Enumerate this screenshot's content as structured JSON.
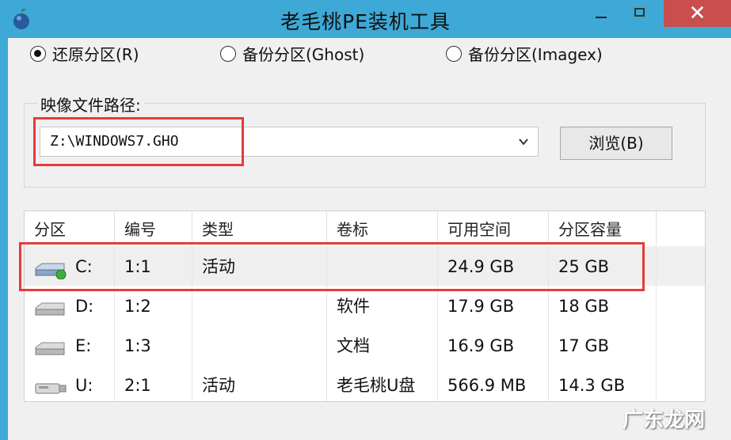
{
  "window": {
    "title": "老毛桃PE装机工具",
    "close_glyph": "✕"
  },
  "mode": {
    "options": [
      {
        "label": "还原分区(R)",
        "checked": true
      },
      {
        "label": "备份分区(Ghost)",
        "checked": false
      },
      {
        "label": "备份分区(Imagex)",
        "checked": false
      }
    ]
  },
  "image_path": {
    "label": "映像文件路径:",
    "value": "Z:\\WINDOWS7.GHO",
    "browse_label": "浏览(B)"
  },
  "partitions": {
    "columns": [
      "分区",
      "编号",
      "类型",
      "卷标",
      "可用空间",
      "分区容量"
    ],
    "rows": [
      {
        "drive": "C:",
        "number": "1:1",
        "type": "活动",
        "label": "",
        "free": "24.9 GB",
        "size": "25 GB",
        "selected": true
      },
      {
        "drive": "D:",
        "number": "1:2",
        "type": "",
        "label": "软件",
        "free": "17.9 GB",
        "size": "18 GB",
        "selected": false
      },
      {
        "drive": "E:",
        "number": "1:3",
        "type": "",
        "label": "文档",
        "free": "16.9 GB",
        "size": "17 GB",
        "selected": false
      },
      {
        "drive": "U:",
        "number": "2:1",
        "type": "活动",
        "label": "老毛桃U盘",
        "free": "566.9 MB",
        "size": "14.3 GB",
        "selected": false
      }
    ]
  },
  "watermark": "广东龙网",
  "colors": {
    "titlebar": "#3ea9d6",
    "close_button": "#c94f4f",
    "highlight": "#e53b3b"
  }
}
